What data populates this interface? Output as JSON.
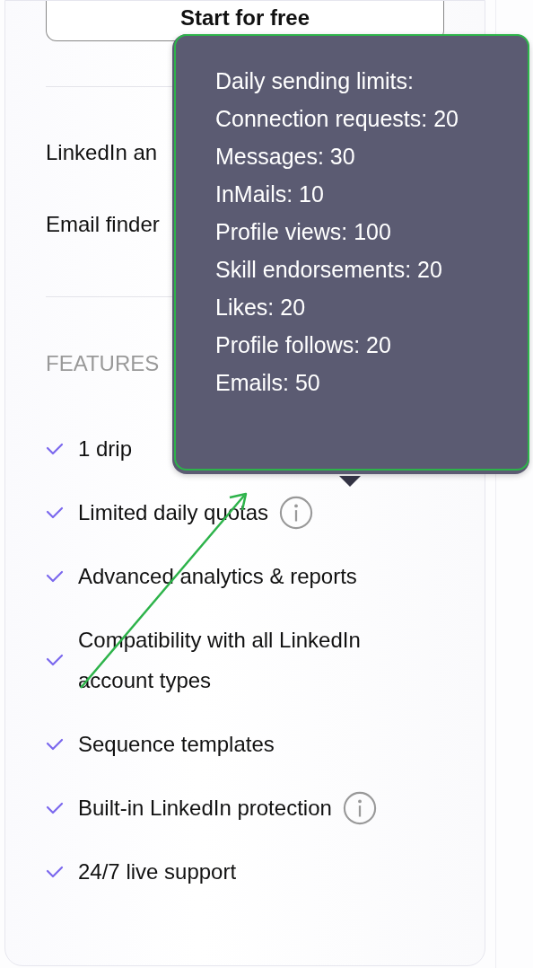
{
  "cta_button": {
    "label": "Start for free"
  },
  "quota_rows": [
    {
      "label": "LinkedIn an"
    },
    {
      "label": "Email finder"
    }
  ],
  "features_heading": "FEATURES",
  "features": [
    {
      "text": "1 drip",
      "info": false
    },
    {
      "text": "Limited daily quotas",
      "info": true
    },
    {
      "text": "Advanced analytics & reports",
      "info": false
    },
    {
      "text": "Compatibility with all LinkedIn account types",
      "info": false
    },
    {
      "text": "Sequence templates",
      "info": false
    },
    {
      "text": "Built-in LinkedIn protection",
      "info": true
    },
    {
      "text": "24/7 live support",
      "info": false
    }
  ],
  "tooltip": {
    "lines": [
      "Daily sending limits:",
      "Connection requests: 20",
      "Messages: 30",
      "InMails: 10",
      "Profile views: 100",
      "Skill endorsements: 20",
      "Likes: 20",
      "Profile follows: 20",
      "Emails: 50"
    ]
  }
}
